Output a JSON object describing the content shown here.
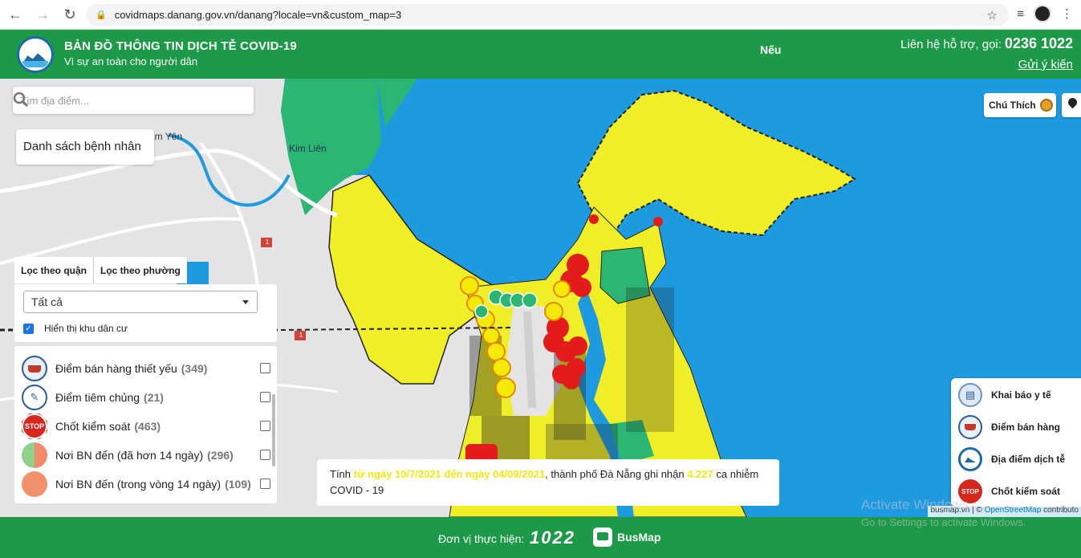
{
  "browser": {
    "url": "covidmaps.danang.gov.vn/danang?locale=vn&custom_map=3"
  },
  "header": {
    "title": "BẢN ĐỒ THÔNG TIN DỊCH TỄ COVID-19",
    "subtitle": "Vì sự an toàn cho người dân",
    "center_label": "Nếu",
    "contact_prefix": "Liên hệ hỗ trợ, gọi:",
    "contact_phone": "0236 1022",
    "feedback_link": "Gửi ý kiến"
  },
  "map": {
    "search_placeholder": "Tìm địa điểm...",
    "patient_list_label": "Danh sách bệnh nhân",
    "place_labels": [
      "am Yên",
      "Kim Liên"
    ],
    "road_number": "1",
    "colors": {
      "sea": "#1e9be0",
      "land": "#e6e6e6",
      "low_risk": "#f0ee26",
      "green_zone": "#2bb673",
      "red_zone": "#e31b1b",
      "header_green": "#1d9a48"
    }
  },
  "filter": {
    "tab_district": "Lọc theo quận",
    "tab_ward": "Lọc theo phường",
    "select_value": "Tất cả",
    "show_residential_label": "Hiển thị khu dân cư"
  },
  "layers": [
    {
      "name": "Điểm bán hàng thiết yếu",
      "count": "(349)",
      "icon": "basket-icon"
    },
    {
      "name": "Điểm tiêm chủng",
      "count": "(21)",
      "icon": "vaccine-icon"
    },
    {
      "name": "Chốt kiểm soát",
      "count": "(463)",
      "icon": "stop-icon"
    },
    {
      "name": "Nơi BN đến (đã hơn 14 ngày)",
      "count": "(296)",
      "icon": "half-circle-icon"
    },
    {
      "name": "Nơi BN đến (trong vòng 14 ngày)",
      "count": "(109)",
      "icon": "orange-circle-icon"
    }
  ],
  "right_controls": {
    "legend_label": "Chú Thích",
    "quick_items": [
      {
        "label": "Khai báo y tế",
        "icon": "medical-declaration-icon"
      },
      {
        "label": "Điểm bán hàng",
        "icon": "basket-icon"
      },
      {
        "label": "Địa điểm dịch tễ",
        "icon": "danang-logo-icon"
      },
      {
        "label": "Chốt kiểm soát",
        "icon": "stop-icon"
      }
    ]
  },
  "info_bar": {
    "prefix": "Tính",
    "range": "từ ngày 10/7/2021 đến ngày 04/09/2021",
    "middle": ", thành phố Đà Nẵng ghi nhận",
    "cases": "4.227",
    "suffix": "ca nhiễm COVID - 19"
  },
  "attribution": {
    "busmap": "busmap.vn",
    "osm": "OpenStreetMap",
    "contrib": "contributo"
  },
  "footer": {
    "label": "Đơn vị thực hiện:",
    "logo1022": "1022",
    "busmap": "BusMap"
  },
  "os_watermark": {
    "line1": "Activate Windows",
    "line2": "Go to Settings to activate Windows."
  }
}
